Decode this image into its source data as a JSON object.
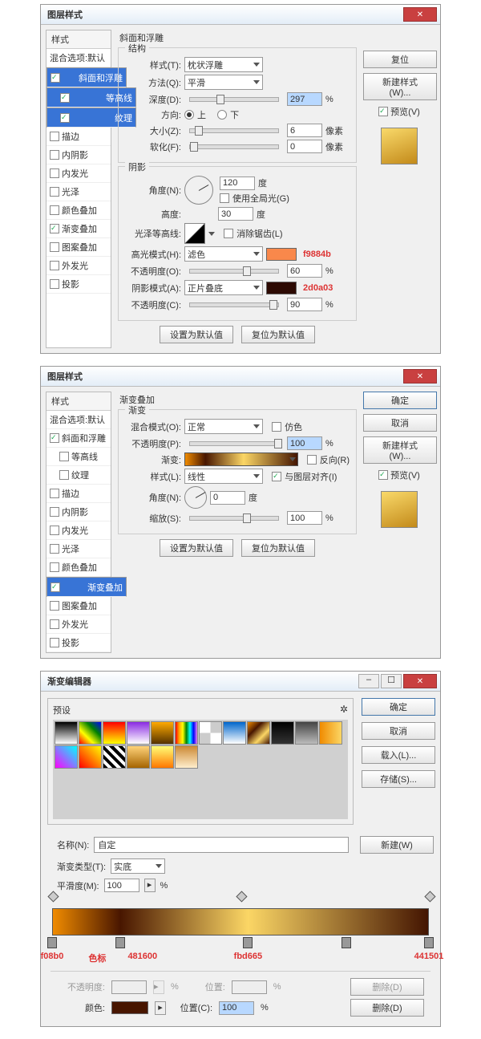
{
  "d1": {
    "title": "图层样式",
    "styles_hdr": "样式",
    "blend_opts": "混合选项:默认",
    "items": [
      {
        "label": "斜面和浮雕",
        "on": true,
        "sel": true
      },
      {
        "label": "等高线",
        "on": true,
        "indent": true,
        "sel": true
      },
      {
        "label": "纹理",
        "on": true,
        "indent": true,
        "sel": true
      },
      {
        "label": "描边",
        "on": false
      },
      {
        "label": "内阴影",
        "on": false
      },
      {
        "label": "内发光",
        "on": false
      },
      {
        "label": "光泽",
        "on": false
      },
      {
        "label": "颜色叠加",
        "on": false
      },
      {
        "label": "渐变叠加",
        "on": true
      },
      {
        "label": "图案叠加",
        "on": false
      },
      {
        "label": "外发光",
        "on": false
      },
      {
        "label": "投影",
        "on": false
      }
    ],
    "panel_title": "斜面和浮雕",
    "g1": "结构",
    "style_lbl": "样式(T):",
    "style_val": "枕状浮雕",
    "tech_lbl": "方法(Q):",
    "tech_val": "平滑",
    "depth_lbl": "深度(D):",
    "depth_val": "297",
    "pct": "%",
    "dir_lbl": "方向:",
    "up": "上",
    "down": "下",
    "size_lbl": "大小(Z):",
    "size_val": "6",
    "px": "像素",
    "soft_lbl": "软化(F):",
    "soft_val": "0",
    "g2": "阴影",
    "angle_lbl": "角度(N):",
    "angle_val": "120",
    "deg": "度",
    "global": "使用全局光(G)",
    "alt_lbl": "高度:",
    "alt_val": "30",
    "gloss_lbl": "光泽等高线:",
    "aa": "消除锯齿(L)",
    "hi_lbl": "高光模式(H):",
    "hi_val": "滤色",
    "hi_color": "#f9884b",
    "hi_ann": "f9884b",
    "hi_op_lbl": "不透明度(O):",
    "hi_op": "60",
    "sh_lbl": "阴影模式(A):",
    "sh_val": "正片叠底",
    "sh_color": "#2d0a03",
    "sh_ann": "2d0a03",
    "sh_op_lbl": "不透明度(C):",
    "sh_op": "90",
    "btn_def": "设置为默认值",
    "btn_reset": "复位为默认值",
    "side": {
      "reset": "复位",
      "newstyle": "新建样式(W)...",
      "preview": "预览(V)"
    }
  },
  "d2": {
    "title": "图层样式",
    "items": [
      {
        "label": "斜面和浮雕",
        "on": true
      },
      {
        "label": "等高线",
        "on": false,
        "indent": true
      },
      {
        "label": "纹理",
        "on": false,
        "indent": true
      },
      {
        "label": "描边",
        "on": false
      },
      {
        "label": "内阴影",
        "on": false
      },
      {
        "label": "内发光",
        "on": false
      },
      {
        "label": "光泽",
        "on": false
      },
      {
        "label": "颜色叠加",
        "on": false
      },
      {
        "label": "渐变叠加",
        "on": true,
        "sel": true
      },
      {
        "label": "图案叠加",
        "on": false
      },
      {
        "label": "外发光",
        "on": false
      },
      {
        "label": "投影",
        "on": false
      }
    ],
    "panel_title": "渐变叠加",
    "g1": "渐变",
    "bm_lbl": "混合模式(O):",
    "bm_val": "正常",
    "dither": "仿色",
    "op_lbl": "不透明度(P):",
    "op_val": "100",
    "pct": "%",
    "grad_lbl": "渐变:",
    "reverse": "反向(R)",
    "style_lbl": "样式(L):",
    "style_val": "线性",
    "align": "与图层对齐(I)",
    "angle_lbl": "角度(N):",
    "angle_val": "0",
    "deg": "度",
    "scale_lbl": "缩放(S):",
    "scale_val": "100",
    "btn_def": "设置为默认值",
    "btn_reset": "复位为默认值",
    "side": {
      "ok": "确定",
      "cancel": "取消",
      "newstyle": "新建样式(W)...",
      "preview": "预览(V)"
    }
  },
  "ge": {
    "title": "渐变编辑器",
    "presets": "预设",
    "ok": "确定",
    "cancel": "取消",
    "load": "载入(L)...",
    "save": "存储(S)...",
    "name_lbl": "名称(N):",
    "name_val": "自定",
    "new": "新建(W)",
    "type_lbl": "渐变类型(T):",
    "type_val": "实底",
    "smooth_lbl": "平滑度(M):",
    "smooth_val": "100",
    "pct": "%",
    "stops_ann": [
      {
        "p": 0,
        "t": "f08b0"
      },
      {
        "p": 12,
        "t": "色标"
      },
      {
        "p": 24,
        "t": "481600"
      },
      {
        "p": 52,
        "t": "fbd665"
      },
      {
        "p": 100,
        "t": "441501"
      }
    ],
    "stops": [
      0,
      18,
      52,
      78,
      100
    ],
    "opstops": [
      0,
      50,
      100
    ],
    "cs_hdr": "色标",
    "op_lbl": "不透明度:",
    "op_pct": "%",
    "loc_lbl": "位置:",
    "del": "删除(D)",
    "color_lbl": "颜色:",
    "loc2_lbl": "位置(C):",
    "loc2_val": "100",
    "sel_color": "#481600"
  }
}
